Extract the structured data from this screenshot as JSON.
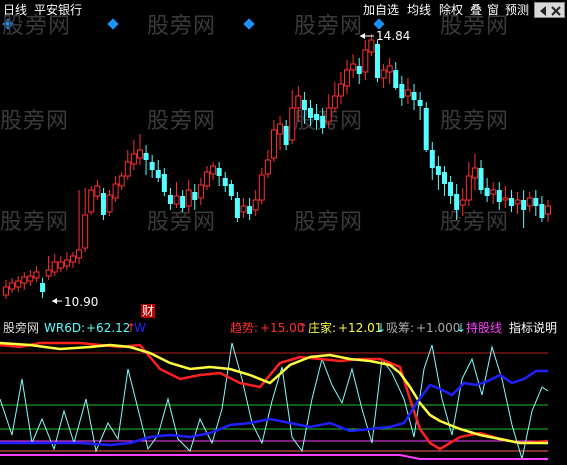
{
  "header": {
    "period_label": "日线",
    "stock_name": "平安银行",
    "toolbar": [
      "加自选",
      "均线",
      "除权",
      "叠",
      "窗",
      "预测"
    ]
  },
  "markers": {
    "high_label": "14.84",
    "low_label": "10.90",
    "cai_label": "财"
  },
  "watermark": "股旁网",
  "indicator": {
    "source": "股旁网",
    "name": "WR6D:",
    "wr_value": "+62.12",
    "wr_arrow": "↑",
    "obscured": "W",
    "trend_label": "趋势:",
    "trend_value": "+15.00",
    "trend_arrow": "↑",
    "dealer_label": "庄家:",
    "dealer_value": "+12.01",
    "dealer_arrow": "↓",
    "absorb_label": "吸筹:",
    "absorb_value": "+1.000",
    "absorb_arrow": "↓",
    "hold_label": "持股线",
    "help_button": "指标说明"
  },
  "colors": {
    "up": "#ff3030",
    "down": "#54ffff",
    "wr": "#ff2020",
    "trend": "#ffff40",
    "dealer": "#2020ff",
    "absorb": "#ff40ff",
    "cyanline": "#80ffff"
  },
  "chart_data": {
    "type": "candlestick",
    "high_value": 14.84,
    "low_value": 10.9
  }
}
